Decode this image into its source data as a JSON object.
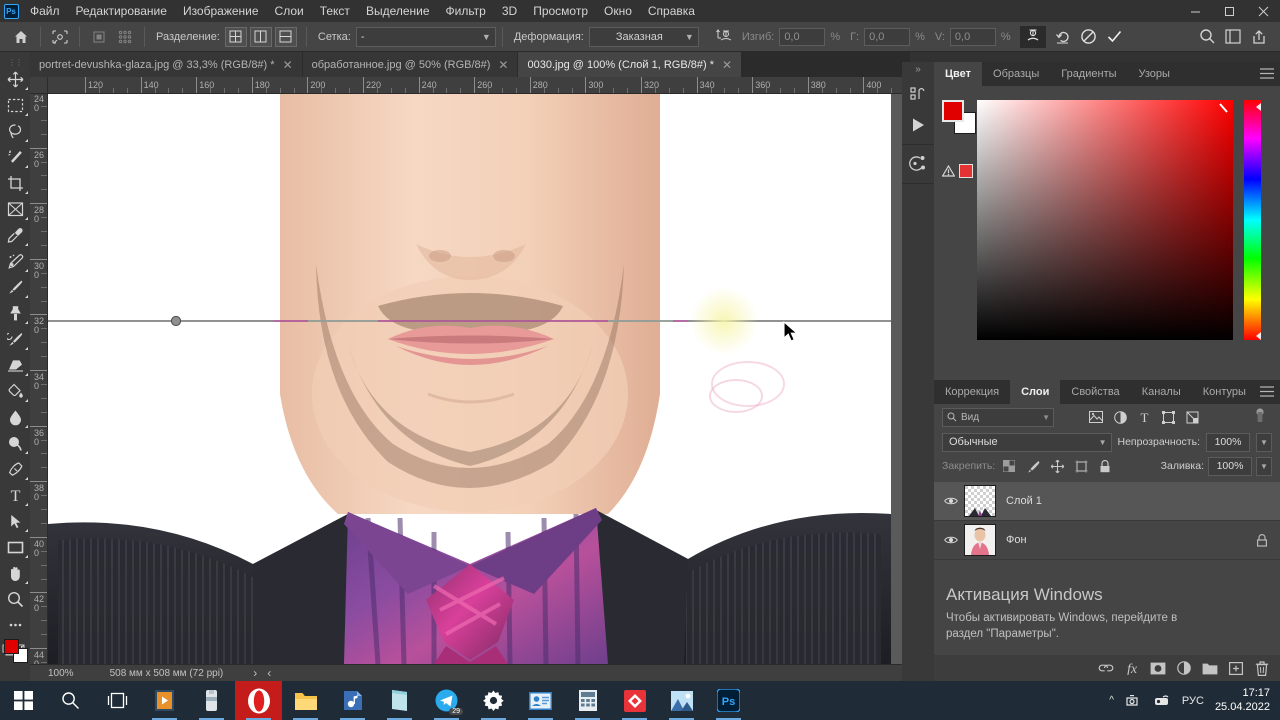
{
  "app": {
    "name": "Adobe Photoshop",
    "logo_text": "Ps"
  },
  "menubar": {
    "items": [
      "Файл",
      "Редактирование",
      "Изображение",
      "Слои",
      "Текст",
      "Выделение",
      "Фильтр",
      "3D",
      "Просмотр",
      "Окно",
      "Справка"
    ],
    "window_controls": {
      "minimize": "—",
      "maximize": "▢",
      "close": "✕"
    }
  },
  "optionsbar": {
    "home_icon": "home-icon",
    "split_label": "Разделение:",
    "grid_label": "Сетка:",
    "grid_value": "-",
    "deform_label": "Деформация:",
    "deform_value": "Заказная",
    "bend_label": "Изгиб:",
    "bend_value": "0,0",
    "bend_unit": "%",
    "h_label": "Г:",
    "h_value": "0,0",
    "h_unit": "%",
    "v_label": "V:",
    "v_value": "0,0",
    "v_unit": "%",
    "reset_icon": "reset-icon",
    "cancel_icon": "cancel-icon",
    "commit_icon": "checkmark-icon",
    "search_icon": "search-icon",
    "workspace_icon": "workspace-icon",
    "share_icon": "share-icon"
  },
  "toolbar": {
    "tools": [
      {
        "name": "move-tool",
        "glyph": "move"
      },
      {
        "name": "marquee-tool",
        "glyph": "marquee"
      },
      {
        "name": "lasso-tool",
        "glyph": "lasso"
      },
      {
        "name": "magic-wand-tool",
        "glyph": "wand"
      },
      {
        "name": "crop-tool",
        "glyph": "crop"
      },
      {
        "name": "frame-tool",
        "glyph": "frame"
      },
      {
        "name": "eyedropper-tool",
        "glyph": "eyedropper"
      },
      {
        "name": "healing-brush-tool",
        "glyph": "heal"
      },
      {
        "name": "brush-tool",
        "glyph": "brush"
      },
      {
        "name": "clone-stamp-tool",
        "glyph": "stamp"
      },
      {
        "name": "history-brush-tool",
        "glyph": "historybrush"
      },
      {
        "name": "eraser-tool",
        "glyph": "eraser"
      },
      {
        "name": "gradient-tool",
        "glyph": "bucket"
      },
      {
        "name": "blur-tool",
        "glyph": "blur"
      },
      {
        "name": "dodge-tool",
        "glyph": "dodge"
      },
      {
        "name": "pen-tool",
        "glyph": "pen"
      },
      {
        "name": "type-tool",
        "glyph": "type"
      },
      {
        "name": "path-selection-tool",
        "glyph": "arrow"
      },
      {
        "name": "rectangle-tool",
        "glyph": "rect"
      },
      {
        "name": "hand-tool",
        "glyph": "hand"
      },
      {
        "name": "zoom-tool",
        "glyph": "zoom"
      },
      {
        "name": "edit-toolbar",
        "glyph": "dots"
      }
    ],
    "foreground_color": "#e00000",
    "background_color": "#ffffff"
  },
  "tabs": [
    {
      "label": "portret-devushka-glaza.jpg @ 33,3% (RGB/8#) *",
      "active": false,
      "close": "✕"
    },
    {
      "label": "обработанное.jpg @ 50% (RGB/8#)",
      "active": false,
      "close": "✕"
    },
    {
      "label": "0030.jpg @ 100% (Слой 1, RGB/8#) *",
      "active": true,
      "close": "✕"
    }
  ],
  "rulers": {
    "horizontal": [
      "120",
      "140",
      "160",
      "180",
      "200",
      "220",
      "240",
      "260",
      "280",
      "300",
      "320",
      "340",
      "360",
      "380",
      "400"
    ],
    "vertical": [
      "240",
      "260",
      "280",
      "300",
      "320",
      "340",
      "360",
      "380",
      "400",
      "420",
      "440"
    ],
    "units": "мм"
  },
  "statusbar": {
    "zoom": "100%",
    "doc_info": "508 мм x 508 мм (72 ppi)",
    "next_arrow": "›",
    "prev_arrow": "‹"
  },
  "rail": {
    "items": [
      {
        "name": "libraries-icon"
      },
      {
        "name": "play-actions-icon"
      },
      {
        "name": "3d-icon"
      }
    ],
    "collapse": "»"
  },
  "color_panel": {
    "tabs": [
      {
        "label": "Цвет",
        "active": true
      },
      {
        "label": "Образцы",
        "active": false
      },
      {
        "label": "Градиенты",
        "active": false
      },
      {
        "label": "Узоры",
        "active": false
      }
    ],
    "menu_icon": "panel-menu-icon",
    "foreground": "#e00000",
    "background": "#ffffff",
    "gamut_warning_icon": "gamut-warning-icon",
    "gamut_swatch": "#e53333"
  },
  "layers_panel": {
    "tabs": [
      {
        "label": "Коррекция",
        "active": false
      },
      {
        "label": "Слои",
        "active": true
      },
      {
        "label": "Свойства",
        "active": false
      },
      {
        "label": "Каналы",
        "active": false
      },
      {
        "label": "Контуры",
        "active": false
      }
    ],
    "menu_icon": "panel-menu-icon",
    "filter_placeholder": "Вид",
    "filter_icons": [
      "pixel-filter-icon",
      "adjustment-filter-icon",
      "type-filter-icon",
      "shape-filter-icon",
      "smart-object-filter-icon"
    ],
    "blend_mode": "Обычные",
    "opacity_label": "Непрозрачность:",
    "opacity_value": "100%",
    "lock_label": "Закрепить:",
    "lock_icons": [
      "lock-transparent-icon",
      "lock-image-icon",
      "lock-position-icon",
      "lock-artboard-icon",
      "lock-all-icon"
    ],
    "fill_label": "Заливка:",
    "fill_value": "100%",
    "layers": [
      {
        "name": "Слой 1",
        "visible": true,
        "selected": true,
        "locked": false,
        "thumb": "transparent"
      },
      {
        "name": "Фон",
        "visible": true,
        "selected": false,
        "locked": true,
        "thumb": "photo"
      }
    ],
    "bottom_buttons": [
      "link-layers-icon",
      "layer-style-fx-icon",
      "layer-mask-icon",
      "adjustment-layer-icon",
      "new-group-icon",
      "new-layer-icon",
      "delete-layer-icon"
    ]
  },
  "windows_activation": {
    "title": "Активация Windows",
    "line1": "Чтобы активировать Windows, перейдите в",
    "line2": "раздел \"Параметры\"."
  },
  "taskbar": {
    "items": [
      {
        "name": "start-button",
        "glyph": "windows"
      },
      {
        "name": "search-button",
        "glyph": "search"
      },
      {
        "name": "task-view-button",
        "glyph": "taskview"
      },
      {
        "name": "media-player-app",
        "glyph": "media",
        "running": true
      },
      {
        "name": "utility-app",
        "glyph": "util",
        "running": true
      },
      {
        "name": "opera-browser",
        "glyph": "opera",
        "running": true,
        "active": false
      },
      {
        "name": "file-explorer",
        "glyph": "folder",
        "running": true
      },
      {
        "name": "music-app",
        "glyph": "music",
        "running": true
      },
      {
        "name": "notes-app",
        "glyph": "notes",
        "running": true
      },
      {
        "name": "telegram-app",
        "glyph": "telegram",
        "running": true,
        "badge": "29"
      },
      {
        "name": "settings-app",
        "glyph": "gear",
        "running": true
      },
      {
        "name": "contacts-app",
        "glyph": "contacts",
        "running": true
      },
      {
        "name": "calculator-app",
        "glyph": "calc",
        "running": true
      },
      {
        "name": "editor-app",
        "glyph": "diamond",
        "running": true
      },
      {
        "name": "photos-app",
        "glyph": "photos",
        "running": true
      },
      {
        "name": "photoshop-app",
        "glyph": "ps",
        "running": true,
        "active": true
      }
    ],
    "tray": {
      "chevron": "^",
      "icons": [
        "onedrive-icon",
        "network-icon"
      ],
      "language": "РУС",
      "time": "17:17",
      "date": "25.04.2022"
    }
  }
}
